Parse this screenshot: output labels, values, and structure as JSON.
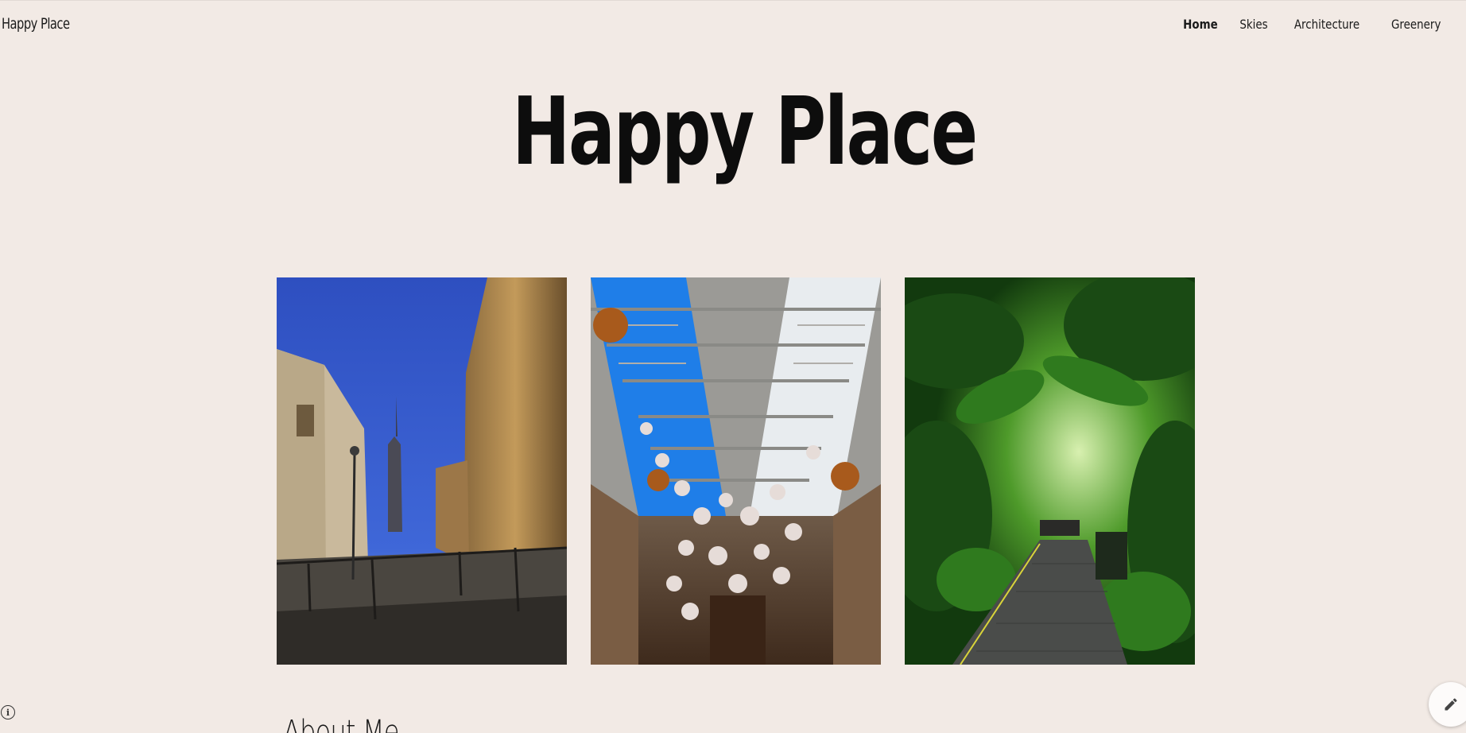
{
  "site": {
    "name": "Happy Place"
  },
  "nav": {
    "items": [
      {
        "label": "Home",
        "active": true
      },
      {
        "label": "Skies",
        "active": false
      },
      {
        "label": "Architecture",
        "active": false
      },
      {
        "label": "Greenery",
        "active": false
      }
    ]
  },
  "hero": {
    "title": "Happy Place"
  },
  "gallery": {
    "images": [
      {
        "subject": "street-with-buildings-and-blue-sky"
      },
      {
        "subject": "glass-roof-hall-with-hanging-heads"
      },
      {
        "subject": "greenhouse-path-with-palms"
      }
    ]
  },
  "section": {
    "heading": "About Me"
  },
  "icons": {
    "info": "info-icon",
    "edit": "pencil-icon"
  },
  "colors": {
    "background": "#f2eae5",
    "text": "#111111"
  }
}
